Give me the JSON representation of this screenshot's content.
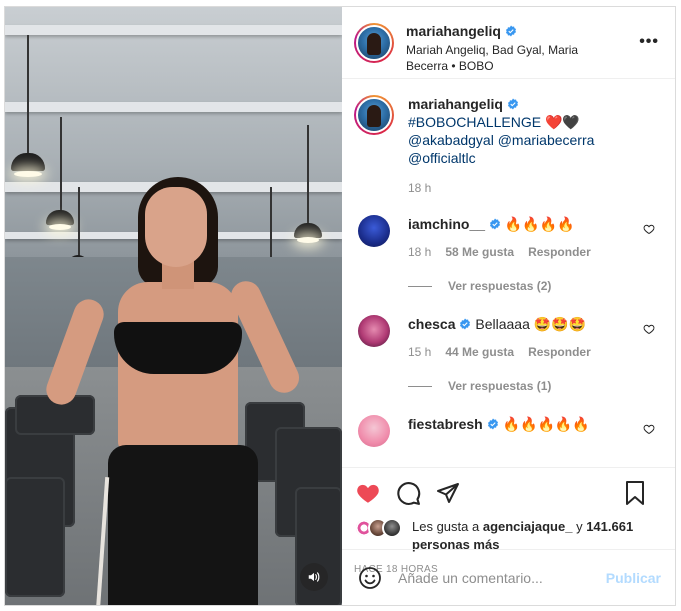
{
  "colors": {
    "like_red": "#ed4956",
    "verified_blue": "#3897f0",
    "link": "#00376b",
    "publish_disabled": "#b3dbff"
  },
  "header": {
    "username": "mariahangeliq",
    "subline": "Mariah Angeliq, Bad Gyal, Maria Becerra • BOBO",
    "more_icon": "more-horizontal-icon",
    "more_label": "•••"
  },
  "caption": {
    "username": "mariahangeliq",
    "hashtag": "#BOBOCHALLENGE",
    "hearts": "❤️🖤",
    "mentions": [
      "@akabadgyal",
      "@mariabecerra",
      "@officialtlc"
    ],
    "time": "18 h"
  },
  "comments": [
    {
      "username": "iamchino__",
      "text": "🔥🔥🔥🔥",
      "time": "18 h",
      "likes": "58 Me gusta",
      "reply": "Responder",
      "replies": "Ver respuestas (2)"
    },
    {
      "username": "chesca",
      "text": "Bellaaaa 🤩🤩🤩",
      "time": "15 h",
      "likes": "44 Me gusta",
      "reply": "Responder",
      "replies": "Ver respuestas (1)"
    },
    {
      "username": "fiestabresh",
      "text": "🔥🔥🔥🔥🔥"
    }
  ],
  "actions": {
    "like_icon": "heart-filled-icon",
    "comment_icon": "comment-icon",
    "share_icon": "share-icon",
    "save_icon": "bookmark-icon"
  },
  "likes": {
    "prefix": "Les gusta a",
    "user": "agenciajaque_",
    "conj": "y",
    "others": "141.661 personas más"
  },
  "posted": "HACE 18 HORAS",
  "add_comment": {
    "placeholder": "Añade un comentario...",
    "publish": "Publicar",
    "emoji_icon": "emoji-icon"
  },
  "media": {
    "sound_icon": "volume-icon"
  }
}
